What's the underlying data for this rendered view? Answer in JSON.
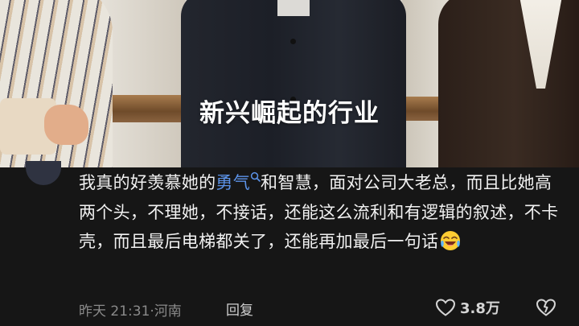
{
  "video": {
    "caption": "新兴崛起的行业"
  },
  "comment": {
    "text_before": "我真的好羡慕她的",
    "keyword": "勇气",
    "text_after": "和智慧，面对公司大老总，而且比她高两个头，不理她，不接话，还能这么流利和有逻辑的叙述，不卡壳，而且最后电梯都关了，还能再加最后一句话",
    "emoji": "laughing-crying-emoji",
    "time": "昨天 21:31",
    "separator": "·",
    "location": "河南",
    "reply_label": "回复",
    "like_count": "3.8万"
  },
  "colors": {
    "background": "#161616",
    "keyword": "#5c93e8",
    "meta": "#8a8a8a"
  },
  "icons": [
    "search-icon",
    "heart-icon",
    "dislike-icon"
  ]
}
